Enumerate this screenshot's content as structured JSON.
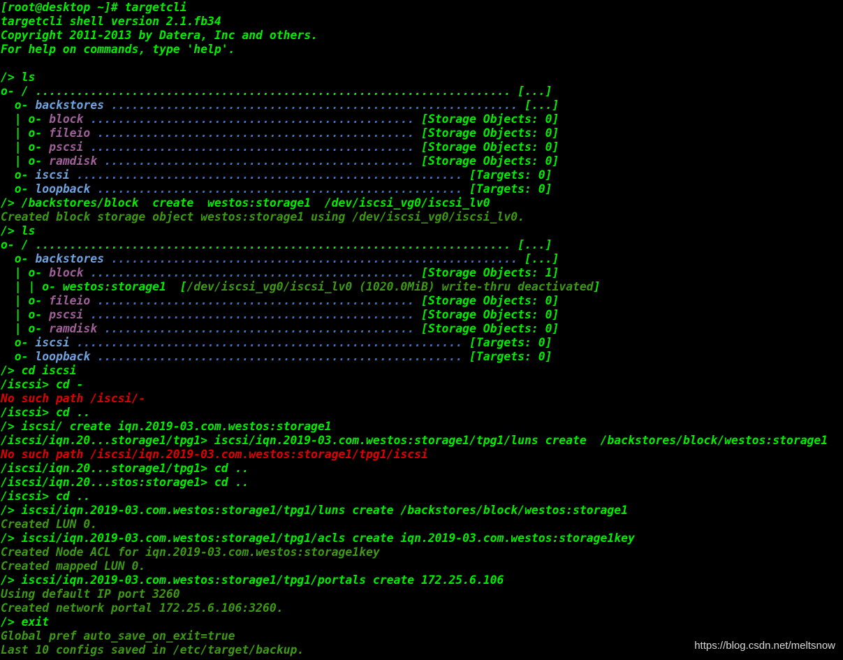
{
  "palette": {
    "green": "#00ee00",
    "dark_green": "#3c9a14",
    "blue_dots": "#3f6fcf",
    "light_blue": "#6fa4e0",
    "magenta": "#a0609a",
    "red": "#e00000",
    "background": "#000000"
  },
  "terminal": {
    "lines": [
      {
        "segs": [
          {
            "t": "[root@desktop ~]# targetcli",
            "c": "g"
          }
        ]
      },
      {
        "segs": [
          {
            "t": "targetcli shell version 2.1.fb34",
            "c": "g"
          }
        ]
      },
      {
        "segs": [
          {
            "t": "Copyright 2011-2013 by Datera, Inc and others.",
            "c": "g"
          }
        ]
      },
      {
        "segs": [
          {
            "t": "For help on commands, type 'help'.",
            "c": "g"
          }
        ]
      },
      {
        "segs": [
          {
            "t": " ",
            "c": "g"
          }
        ]
      },
      {
        "segs": [
          {
            "t": "/> ls",
            "c": "g"
          }
        ]
      },
      {
        "segs": [
          {
            "t": "o- / ",
            "c": "g"
          },
          {
            "t": "..................................................................... ",
            "c": "g"
          },
          {
            "t": "[...]",
            "c": "g"
          }
        ]
      },
      {
        "segs": [
          {
            "t": "  o- ",
            "c": "g"
          },
          {
            "t": "backstores",
            "c": "lb"
          },
          {
            "t": " ........................................................... ",
            "c": "b"
          },
          {
            "t": "[...]",
            "c": "g"
          }
        ]
      },
      {
        "segs": [
          {
            "t": "  | o- ",
            "c": "g"
          },
          {
            "t": "block",
            "c": "m"
          },
          {
            "t": " ............................................... ",
            "c": "b"
          },
          {
            "t": "[Storage Objects: 0]",
            "c": "g"
          }
        ]
      },
      {
        "segs": [
          {
            "t": "  | o- ",
            "c": "g"
          },
          {
            "t": "fileio",
            "c": "m"
          },
          {
            "t": " .............................................. ",
            "c": "b"
          },
          {
            "t": "[Storage Objects: 0]",
            "c": "g"
          }
        ]
      },
      {
        "segs": [
          {
            "t": "  | o- ",
            "c": "g"
          },
          {
            "t": "pscsi",
            "c": "m"
          },
          {
            "t": " ............................................... ",
            "c": "b"
          },
          {
            "t": "[Storage Objects: 0]",
            "c": "g"
          }
        ]
      },
      {
        "segs": [
          {
            "t": "  | o- ",
            "c": "g"
          },
          {
            "t": "ramdisk",
            "c": "m"
          },
          {
            "t": " ............................................. ",
            "c": "b"
          },
          {
            "t": "[Storage Objects: 0]",
            "c": "g"
          }
        ]
      },
      {
        "segs": [
          {
            "t": "  o- ",
            "c": "g"
          },
          {
            "t": "iscsi",
            "c": "lb"
          },
          {
            "t": " ........................................................ ",
            "c": "b"
          },
          {
            "t": "[Targets: 0]",
            "c": "g"
          }
        ]
      },
      {
        "segs": [
          {
            "t": "  o- ",
            "c": "g"
          },
          {
            "t": "loopback",
            "c": "lb"
          },
          {
            "t": " ..................................................... ",
            "c": "b"
          },
          {
            "t": "[Targets: 0]",
            "c": "g"
          }
        ]
      },
      {
        "segs": [
          {
            "t": "/> /backstores/block  create  westos:storage1  /dev/iscsi_vg0/iscsi_lv0",
            "c": "g"
          }
        ]
      },
      {
        "segs": [
          {
            "t": "Created block storage object westos:storage1 using /dev/iscsi_vg0/iscsi_lv0.",
            "c": "dg"
          }
        ]
      },
      {
        "segs": [
          {
            "t": "/> ls",
            "c": "g"
          }
        ]
      },
      {
        "segs": [
          {
            "t": "o- / ",
            "c": "g"
          },
          {
            "t": "..................................................................... ",
            "c": "g"
          },
          {
            "t": "[...]",
            "c": "g"
          }
        ]
      },
      {
        "segs": [
          {
            "t": "  o- ",
            "c": "g"
          },
          {
            "t": "backstores",
            "c": "lb"
          },
          {
            "t": " ........................................................... ",
            "c": "b"
          },
          {
            "t": "[...]",
            "c": "g"
          }
        ]
      },
      {
        "segs": [
          {
            "t": "  | o- ",
            "c": "g"
          },
          {
            "t": "block",
            "c": "m"
          },
          {
            "t": " ............................................... ",
            "c": "b"
          },
          {
            "t": "[Storage Objects: 1]",
            "c": "g"
          }
        ]
      },
      {
        "segs": [
          {
            "t": "  | | o- ",
            "c": "g"
          },
          {
            "t": "westos:storage1",
            "c": "g"
          },
          {
            "t": "  [",
            "c": "g"
          },
          {
            "t": "/dev/iscsi_vg0/iscsi_lv0 (1020.0MiB) write-thru deactivated",
            "c": "dg"
          },
          {
            "t": "]",
            "c": "g"
          }
        ]
      },
      {
        "segs": [
          {
            "t": "  | o- ",
            "c": "g"
          },
          {
            "t": "fileio",
            "c": "m"
          },
          {
            "t": " .............................................. ",
            "c": "b"
          },
          {
            "t": "[Storage Objects: 0]",
            "c": "g"
          }
        ]
      },
      {
        "segs": [
          {
            "t": "  | o- ",
            "c": "g"
          },
          {
            "t": "pscsi",
            "c": "m"
          },
          {
            "t": " ............................................... ",
            "c": "b"
          },
          {
            "t": "[Storage Objects: 0]",
            "c": "g"
          }
        ]
      },
      {
        "segs": [
          {
            "t": "  | o- ",
            "c": "g"
          },
          {
            "t": "ramdisk",
            "c": "m"
          },
          {
            "t": " ............................................. ",
            "c": "b"
          },
          {
            "t": "[Storage Objects: 0]",
            "c": "g"
          }
        ]
      },
      {
        "segs": [
          {
            "t": "  o- ",
            "c": "g"
          },
          {
            "t": "iscsi",
            "c": "lb"
          },
          {
            "t": " ........................................................ ",
            "c": "b"
          },
          {
            "t": "[Targets: 0]",
            "c": "g"
          }
        ]
      },
      {
        "segs": [
          {
            "t": "  o- ",
            "c": "g"
          },
          {
            "t": "loopback",
            "c": "lb"
          },
          {
            "t": " ..................................................... ",
            "c": "b"
          },
          {
            "t": "[Targets: 0]",
            "c": "g"
          }
        ]
      },
      {
        "segs": [
          {
            "t": "/> cd iscsi",
            "c": "g"
          }
        ]
      },
      {
        "segs": [
          {
            "t": "/iscsi> cd -",
            "c": "g"
          }
        ]
      },
      {
        "segs": [
          {
            "t": "No such path /iscsi/-",
            "c": "r"
          }
        ]
      },
      {
        "segs": [
          {
            "t": "/iscsi> cd ..",
            "c": "g"
          }
        ]
      },
      {
        "segs": [
          {
            "t": "/> iscsi/ create iqn.2019-03.com.westos:storage1",
            "c": "g"
          }
        ]
      },
      {
        "segs": [
          {
            "t": "/iscsi/iqn.20...storage1/tpg1> iscsi/iqn.2019-03.com.westos:storage1/tpg1/luns create  /backstores/block/westos:storage1",
            "c": "g"
          }
        ]
      },
      {
        "segs": [
          {
            "t": "No such path /iscsi/iqn.2019-03.com.westos:storage1/tpg1/iscsi",
            "c": "r"
          }
        ]
      },
      {
        "segs": [
          {
            "t": "/iscsi/iqn.20...storage1/tpg1> cd ..",
            "c": "g"
          }
        ]
      },
      {
        "segs": [
          {
            "t": "/iscsi/iqn.20...stos:storage1> cd ..",
            "c": "g"
          }
        ]
      },
      {
        "segs": [
          {
            "t": "/iscsi> cd ..",
            "c": "g"
          }
        ]
      },
      {
        "segs": [
          {
            "t": "/> iscsi/iqn.2019-03.com.westos:storage1/tpg1/luns create /backstores/block/westos:storage1",
            "c": "g"
          }
        ]
      },
      {
        "segs": [
          {
            "t": "Created LUN 0.",
            "c": "dg"
          }
        ]
      },
      {
        "segs": [
          {
            "t": "/> iscsi/iqn.2019-03.com.westos:storage1/tpg1/acls create iqn.2019-03.com.westos:storage1key",
            "c": "g"
          }
        ]
      },
      {
        "segs": [
          {
            "t": "Created Node ACL for iqn.2019-03.com.westos:storage1key",
            "c": "dg"
          }
        ]
      },
      {
        "segs": [
          {
            "t": "Created mapped LUN 0.",
            "c": "dg"
          }
        ]
      },
      {
        "segs": [
          {
            "t": "/> iscsi/iqn.2019-03.com.westos:storage1/tpg1/portals create 172.25.6.106",
            "c": "g"
          }
        ]
      },
      {
        "segs": [
          {
            "t": "Using default IP port 3260",
            "c": "dg"
          }
        ]
      },
      {
        "segs": [
          {
            "t": "Created network portal 172.25.6.106:3260.",
            "c": "dg"
          }
        ]
      },
      {
        "segs": [
          {
            "t": "/> exit",
            "c": "g"
          }
        ]
      },
      {
        "segs": [
          {
            "t": "Global pref auto_save_on_exit=true",
            "c": "dg"
          }
        ]
      },
      {
        "segs": [
          {
            "t": "Last 10 configs saved in /etc/target/backup.",
            "c": "dg"
          }
        ]
      }
    ]
  },
  "watermark": "https://blog.csdn.net/meltsnow"
}
